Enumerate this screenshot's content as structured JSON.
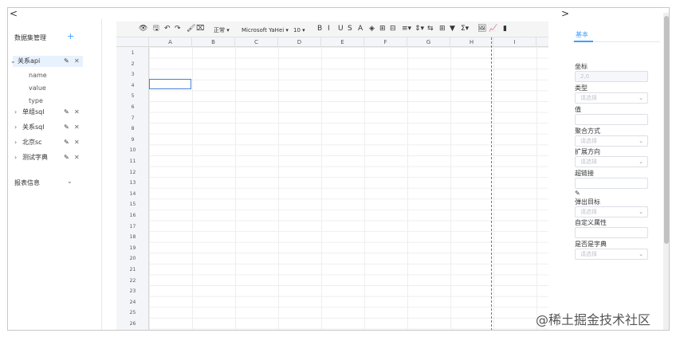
{
  "nav": {
    "left_collapse": "<",
    "right_collapse": ">"
  },
  "left_panel": {
    "title": "数据集管理",
    "add_icon": "+",
    "datasets": [
      {
        "name": "关系api",
        "expanded": true,
        "fields": [
          "name",
          "value",
          "type"
        ]
      },
      {
        "name": "单组sql",
        "expanded": false
      },
      {
        "name": "关系sql",
        "expanded": false
      },
      {
        "name": "北京sc",
        "expanded": false
      },
      {
        "name": "测试字典",
        "expanded": false
      }
    ],
    "report_info": "报表信息"
  },
  "toolbar": {
    "items": [
      "👁",
      "🖫",
      "↶",
      "↷",
      "🖌",
      "⌧",
      "正常 ▾",
      "Microsoft YaHei ▾",
      "10 ▾",
      "B",
      "I",
      "U",
      "S",
      "A",
      "◈",
      "⊞",
      "⊟",
      "≡▾",
      "⇕▾",
      "⇆",
      "⊞",
      "▼",
      "Σ▾",
      "🖼",
      "📈",
      "▮"
    ]
  },
  "sheet": {
    "columns": [
      "A",
      "B",
      "C",
      "D",
      "E",
      "F",
      "G",
      "H",
      "I"
    ],
    "rows": [
      "1",
      "2",
      "3",
      "4",
      "5",
      "6",
      "7",
      "8",
      "9",
      "10",
      "11",
      "12",
      "13",
      "14",
      "15",
      "16",
      "17",
      "18",
      "19",
      "20",
      "21",
      "22",
      "23",
      "24",
      "25",
      "26"
    ],
    "selected_cell": "A3"
  },
  "right_panel": {
    "tab": "基本",
    "coord_label": "坐标",
    "coord_value": "2,0",
    "type_label": "类型",
    "type_placeholder": "请选择",
    "value_label": "值",
    "agg_label": "聚合方式",
    "agg_placeholder": "请选择",
    "expand_label": "扩展方向",
    "expand_placeholder": "请选择",
    "hyperlink_label": "超链接",
    "popup_label": "弹出目标",
    "popup_placeholder": "请选择",
    "custom_attr_label": "自定义属性",
    "dict_label": "是否是字典",
    "dict_placeholder": "请选择"
  },
  "watermark": "@稀土掘金技术社区",
  "icons": {
    "edit": "pencil-icon",
    "delete": "close-icon",
    "add": "plus-icon",
    "dropdown": "chevron-down-icon"
  }
}
